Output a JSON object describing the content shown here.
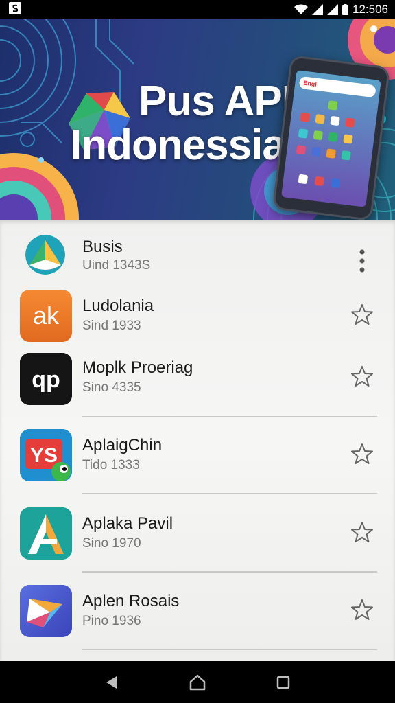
{
  "status_bar": {
    "time": "12:506"
  },
  "banner": {
    "title_line1": "Pus APR",
    "title_line2": "Indonessia",
    "phone_search_text": "Engl"
  },
  "apps": [
    {
      "name": "Busis",
      "subtitle": "Uind 1343S",
      "action": "more-vert"
    },
    {
      "name": "Ludolania",
      "subtitle": "Sind 1933",
      "action": "star"
    },
    {
      "name": "Moplk Proeriag",
      "subtitle": "Sino 4335",
      "action": "star"
    },
    {
      "name": "AplaigChin",
      "subtitle": "Tido 1333",
      "action": "star"
    },
    {
      "name": "Aplaka Pavil",
      "subtitle": "Sino 1970",
      "action": "star"
    },
    {
      "name": "Aplen Rosais",
      "subtitle": "Pino 1936",
      "action": "star"
    }
  ],
  "icons": {
    "ludolania_glyph": "ak",
    "moplk_glyph": "qp",
    "aplaigchin_glyph": "YS"
  },
  "colors": {
    "ludolania_bg": "#ee7a2a",
    "moplk_bg": "#151515",
    "aplaigchin_bg": "#1f8fd0",
    "aplaka_bg": "#1ea39a",
    "aplen_bg": "#4a5bd0"
  }
}
